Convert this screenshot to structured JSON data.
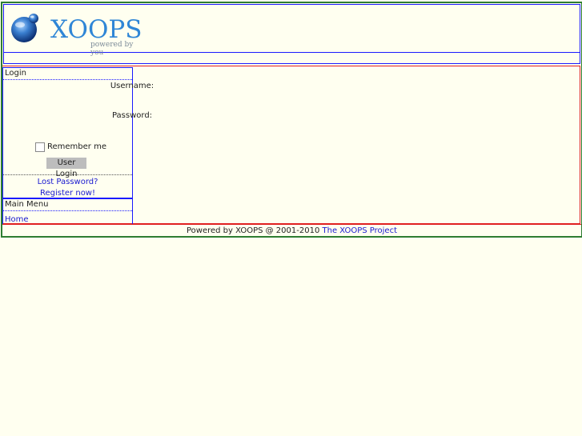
{
  "header": {
    "logo_text": "XOOPS",
    "logo_tagline": "powered by you"
  },
  "login": {
    "title": "Login",
    "username_label": "Username:",
    "username_value": "",
    "password_label": "Password:",
    "password_value": "",
    "remember_label": "Remember me",
    "submit_label": "User Login",
    "lost_password": "Lost Password?",
    "register": "Register now!"
  },
  "main_menu": {
    "title": "Main Menu",
    "items": [
      {
        "label": "Home"
      }
    ]
  },
  "footer": {
    "text": "Powered by XOOPS @ 2001-2010 ",
    "link": "The XOOPS Project"
  },
  "colors": {
    "background": "#fffff0",
    "link": "#1a1ad0",
    "logo_blue": "#2f86d6"
  }
}
